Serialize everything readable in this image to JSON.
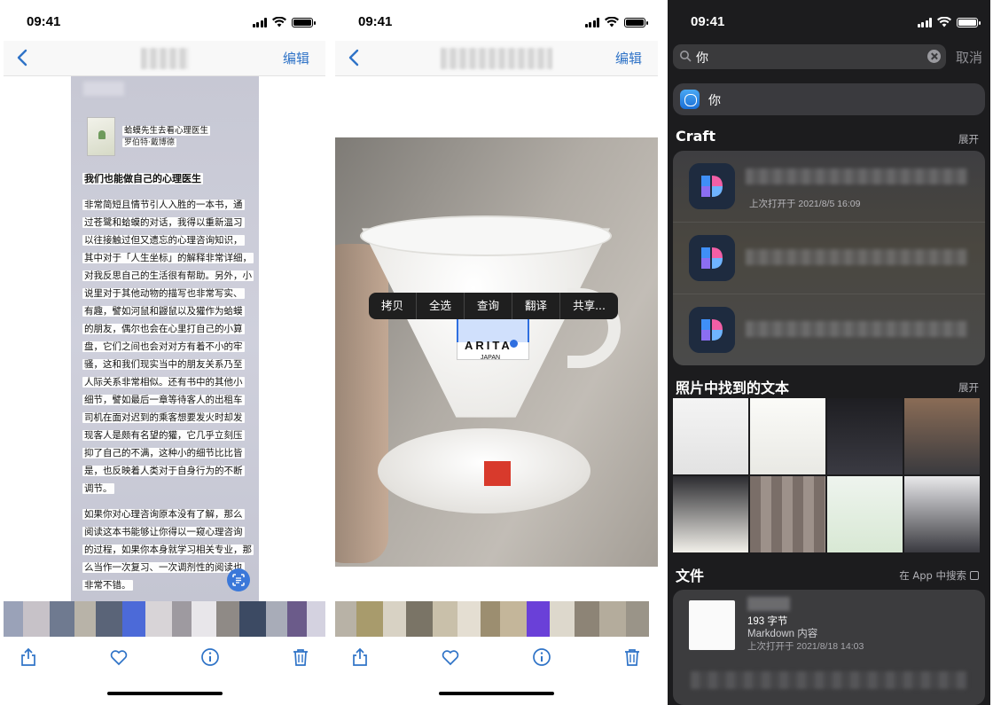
{
  "status_bar": {
    "time": "09:41"
  },
  "phone1": {
    "nav": {
      "edit": "编辑"
    },
    "book": {
      "title": "蛤蟆先生去看心理医生",
      "author": "罗伯特·戴博德"
    },
    "heading": "我们也能做自己的心理医生",
    "lines": [
      "非常简短且情节引人入胜的一本书，通",
      "过苍鹭和蛤蟆的对话，我得以重新温习",
      "以往接触过但又遗忘的心理咨询知识，",
      "其中对于「人生坐标」的解释非常详细，",
      "对我反思自己的生活很有帮助。另外，小",
      "说里对于其他动物的描写也非常写实、",
      "有趣，譬如河鼠和鼹鼠以及獾作为蛤蟆",
      "的朋友，偶尔也会在心里打自己的小算",
      "盘，它们之间也会对对方有着不小的牢",
      "骚，这和我们现实当中的朋友关系乃至",
      "人际关系非常相似。还有书中的其他小",
      "细节，譬如最后一章等待客人的出租车",
      "司机在面对迟到的乘客想要发火时却发",
      "现客人是颇有名望的獾，它几乎立刻压",
      "抑了自己的不满，这种小的细节比比皆",
      "是，也反映着人类对于自身行为的不断",
      "调节。"
    ],
    "lines2": [
      "如果你对心理咨询原本没有了解，那么",
      "阅读这本书能够让你得以一窥心理咨询",
      "的过程，如果你本身就学习相关专业，那",
      "么当作一次复习、一次调剂性的阅读也",
      "非常不错。"
    ]
  },
  "phone2": {
    "nav": {
      "edit": "编辑"
    },
    "context_menu": [
      "拷贝",
      "全选",
      "查询",
      "翻译",
      "共享..."
    ],
    "label": {
      "brand": "ARITA",
      "origin": "JAPAN"
    }
  },
  "phone3": {
    "search": {
      "query": "你",
      "cancel": "取消"
    },
    "safari_suggestion": "你",
    "craft": {
      "header": "Craft",
      "more": "展开",
      "first_item_subtitle": "上次打开于 2021/8/5 16:09"
    },
    "photos": {
      "header": "照片中找到的文本",
      "more": "展开"
    },
    "files": {
      "header": "文件",
      "more": "在 App 中搜索",
      "size": "193 字节",
      "type": "Markdown 内容",
      "date": "上次打开于 2021/8/18 14:03"
    }
  },
  "icons": [
    "back-chevron-icon",
    "share-icon",
    "heart-icon",
    "info-icon",
    "trash-icon",
    "search-icon",
    "clear-icon",
    "safari-icon",
    "craft-app-icon",
    "live-text-icon",
    "open-external-icon"
  ],
  "colors": {
    "ios_blue": "#2f73c7",
    "dark_bg": "#1c1c1e",
    "selection": "#2f6fe0"
  }
}
